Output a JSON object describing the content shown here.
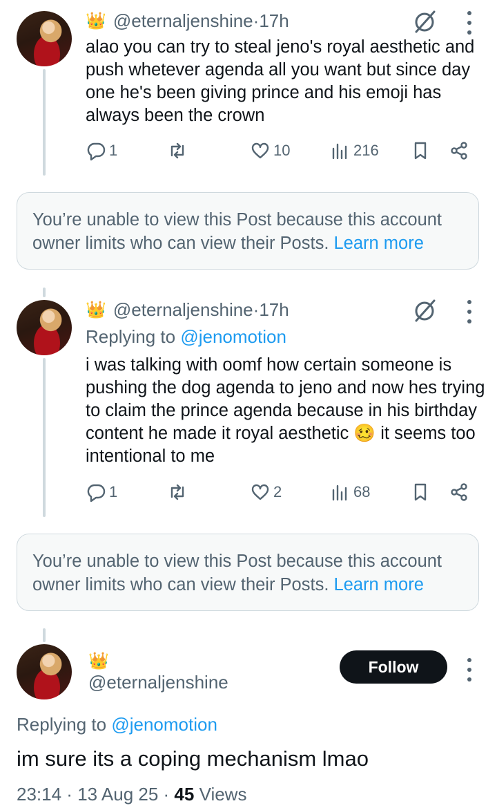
{
  "tweets": [
    {
      "crown": "👑",
      "handle": "@eternaljenshine",
      "sep": " · ",
      "time": "17h",
      "text": "alao you can try to steal jeno's royal aesthetic and push whetever agenda all you want but since day one he's been giving prince and his emoji has always been the crown",
      "replies": "1",
      "retweets": "",
      "likes": "10",
      "views": "216"
    },
    {
      "crown": "👑",
      "handle": "@eternaljenshine",
      "sep": " · ",
      "time": "17h",
      "replying_prefix": "Replying to ",
      "replying_to": "@jenomotion",
      "text_before_emoji": "i was talking with oomf how certain someone is pushing the dog agenda to jeno and now hes trying to claim the prince agenda because in his birthday content he made it royal aesthetic ",
      "emoji": "🥴",
      "text_after_emoji": " it seems too intentional to me",
      "replies": "1",
      "retweets": "",
      "likes": "2",
      "views": "68"
    }
  ],
  "notices": [
    {
      "text": "You’re unable to view this Post because this account owner limits who can view their Posts. ",
      "link": "Learn more"
    },
    {
      "text": "You’re unable to view this Post because this account owner limits who can view their Posts. ",
      "link": "Learn more"
    }
  ],
  "main_post": {
    "crown": "👑",
    "handle": "@eternaljenshine",
    "follow_label": "Follow",
    "replying_prefix": "Replying to ",
    "replying_to": "@jenomotion",
    "text": "im sure its a coping mechanism lmao",
    "time": "23:14",
    "date": "13 Aug 25",
    "dot": " · ",
    "views_count": "45",
    "views_label": " Views"
  },
  "colors": {
    "accent": "#1d9bf0",
    "secondary_text": "#536471",
    "primary_text": "#0f1419",
    "follow_button": "#0f1419"
  },
  "icons": [
    "reply-icon",
    "retweet-icon",
    "like-icon",
    "views-icon",
    "bookmark-icon",
    "share-icon",
    "grok-icon",
    "more-icon"
  ]
}
